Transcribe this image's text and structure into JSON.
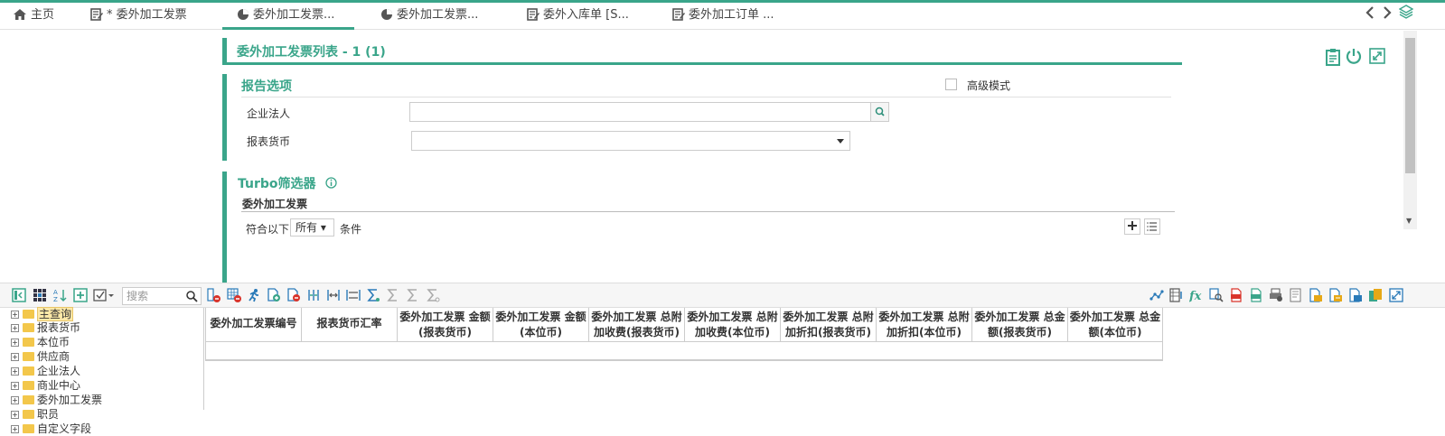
{
  "tabs": [
    {
      "label": "主页",
      "icon": "home-icon"
    },
    {
      "label": "* 委外加工发票",
      "icon": "edit-doc-icon"
    },
    {
      "label": "委外加工发票...",
      "icon": "pie-chart-icon"
    },
    {
      "label": "委外加工发票...",
      "icon": "pie-chart-icon"
    },
    {
      "label": "委外入库单 [S...",
      "icon": "edit-doc-icon"
    },
    {
      "label": "委外加工订单 ...",
      "icon": "edit-doc-icon"
    }
  ],
  "report": {
    "title": "委外加工发票列表 - 1 (1)",
    "options_title": "报告选项",
    "advanced_mode": "高级模式",
    "fields": [
      {
        "label": "企业法人",
        "value": ""
      },
      {
        "label": "报表货币",
        "value": ""
      }
    ],
    "turbo_title": "Turbo筛选器",
    "turbo_sub": "委外加工发票",
    "match_label": "符合以下",
    "match_value": "所有",
    "condition_label": "条件"
  },
  "toolbar": {
    "search_placeholder": "搜索"
  },
  "tree": [
    {
      "label": "主查询",
      "selected": true
    },
    {
      "label": "报表货币"
    },
    {
      "label": "本位币"
    },
    {
      "label": "供应商"
    },
    {
      "label": "企业法人"
    },
    {
      "label": "商业中心"
    },
    {
      "label": "委外加工发票"
    },
    {
      "label": "职员"
    },
    {
      "label": "自定义字段"
    }
  ],
  "grid": {
    "columns": [
      "委外加工发票编号",
      "报表货币汇率",
      "委外加工发票 金额(报表货币)",
      "委外加工发票 金额(本位币)",
      "委外加工发票 总附加收费(报表货币)",
      "委外加工发票 总附加收费(本位币)",
      "委外加工发票 总附加折扣(报表货币)",
      "委外加工发票 总附加折扣(本位币)",
      "委外加工发票 总金额(报表货币)",
      "委外加工发票 总金额(本位币)"
    ]
  },
  "colors": {
    "accent": "#3aa58a",
    "tool_blue": "#2a7ab8",
    "tool_red": "#d9342b"
  }
}
